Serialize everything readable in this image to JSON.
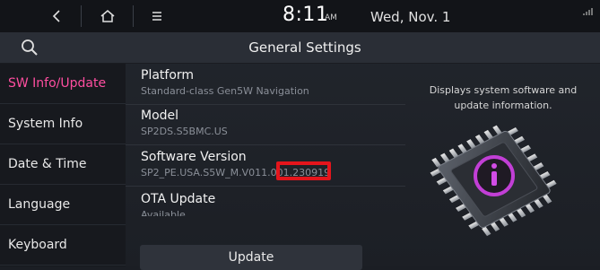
{
  "status_bar": {
    "back_icon": "back-chevron-icon",
    "home_icon": "home-icon",
    "menu_icon": "menu-icon",
    "time": "8:11",
    "ampm": "AM",
    "date": "Wed, Nov. 1",
    "signal_icon": "signal-icon"
  },
  "header": {
    "search_icon": "search-icon",
    "title": "General Settings"
  },
  "sidebar": {
    "items": [
      {
        "label": "SW Info/Update",
        "active": true
      },
      {
        "label": "System Info",
        "active": false
      },
      {
        "label": "Date & Time",
        "active": false
      },
      {
        "label": "Language",
        "active": false
      },
      {
        "label": "Keyboard",
        "active": false
      }
    ]
  },
  "main": {
    "rows": [
      {
        "title": "Platform",
        "value": "Standard-class Gen5W Navigation"
      },
      {
        "title": "Model",
        "value": "SP2DS.S5BMC.US"
      },
      {
        "title": "Software Version",
        "value": "SP2_PE.USA.S5W_M.V011.00",
        "highlighted_suffix": "1.230919"
      },
      {
        "title": "OTA Update",
        "value": "Available"
      }
    ],
    "update_button": "Update"
  },
  "info_panel": {
    "description": "Displays system software and update information."
  },
  "colors": {
    "active_accent": "#ff4ea0",
    "highlight_box": "#e4151c"
  }
}
